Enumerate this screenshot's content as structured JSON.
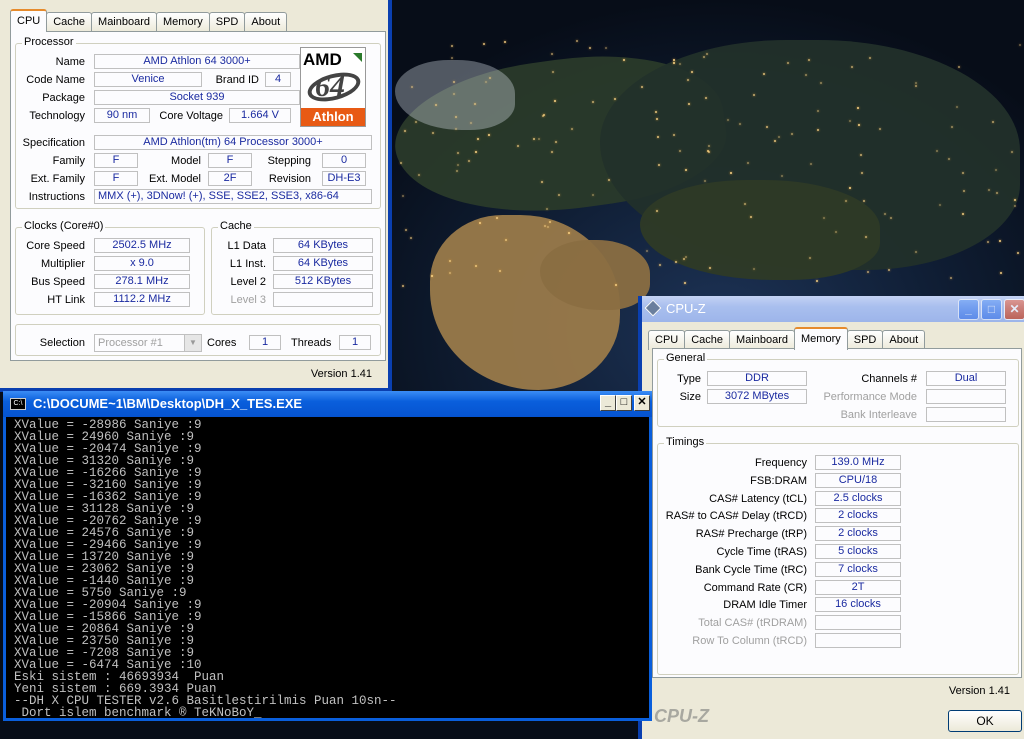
{
  "cpuz_main": {
    "tabs": [
      "CPU",
      "Cache",
      "Mainboard",
      "Memory",
      "SPD",
      "About"
    ],
    "processor": {
      "group_title": "Processor",
      "name_label": "Name",
      "name": "AMD Athlon 64 3000+",
      "codename_label": "Code Name",
      "codename": "Venice",
      "brandid_label": "Brand ID",
      "brandid": "4",
      "package_label": "Package",
      "package": "Socket 939",
      "technology_label": "Technology",
      "technology": "90 nm",
      "corevoltage_label": "Core Voltage",
      "corevoltage": "1.664 V",
      "spec_label": "Specification",
      "spec": "AMD Athlon(tm) 64 Processor 3000+",
      "family_label": "Family",
      "family": "F",
      "model_label": "Model",
      "model": "F",
      "stepping_label": "Stepping",
      "stepping": "0",
      "extfamily_label": "Ext. Family",
      "extfamily": "F",
      "extmodel_label": "Ext. Model",
      "extmodel": "2F",
      "revision_label": "Revision",
      "revision": "DH-E3",
      "instructions_label": "Instructions",
      "instructions": "MMX (+), 3DNow! (+), SSE, SSE2, SSE3, x86-64"
    },
    "logo": {
      "brand": "AMD",
      "number": "64",
      "product": "Athlon"
    },
    "clocks": {
      "group_title": "Clocks (Core#0)",
      "corespeed_label": "Core Speed",
      "corespeed": "2502.5 MHz",
      "multiplier_label": "Multiplier",
      "multiplier": "x 9.0",
      "busspeed_label": "Bus Speed",
      "busspeed": "278.1 MHz",
      "htlink_label": "HT Link",
      "htlink": "1112.2 MHz"
    },
    "cache": {
      "group_title": "Cache",
      "l1data_label": "L1 Data",
      "l1data": "64 KBytes",
      "l1inst_label": "L1 Inst.",
      "l1inst": "64 KBytes",
      "level2_label": "Level 2",
      "level2": "512 KBytes",
      "level3_label": "Level 3",
      "level3": ""
    },
    "selection_label": "Selection",
    "selection": "Processor #1",
    "cores_label": "Cores",
    "cores": "1",
    "threads_label": "Threads",
    "threads": "1",
    "version": "Version 1.41"
  },
  "cpuz_memory": {
    "title": "CPU-Z",
    "tabs": [
      "CPU",
      "Cache",
      "Mainboard",
      "Memory",
      "SPD",
      "About"
    ],
    "general": {
      "group_title": "General",
      "type_label": "Type",
      "type": "DDR",
      "size_label": "Size",
      "size": "3072 MBytes",
      "channels_label": "Channels #",
      "channels": "Dual",
      "perfmode_label": "Performance Mode",
      "perfmode": "",
      "bankinterleave_label": "Bank Interleave",
      "bankinterleave": ""
    },
    "timings": {
      "group_title": "Timings",
      "rows": [
        {
          "label": "Frequency",
          "value": "139.0 MHz",
          "disabled": false
        },
        {
          "label": "FSB:DRAM",
          "value": "CPU/18",
          "disabled": false
        },
        {
          "label": "CAS# Latency (tCL)",
          "value": "2.5 clocks",
          "disabled": false
        },
        {
          "label": "RAS# to CAS# Delay (tRCD)",
          "value": "2 clocks",
          "disabled": false
        },
        {
          "label": "RAS# Precharge (tRP)",
          "value": "2 clocks",
          "disabled": false
        },
        {
          "label": "Cycle Time (tRAS)",
          "value": "5 clocks",
          "disabled": false
        },
        {
          "label": "Bank Cycle Time (tRC)",
          "value": "7 clocks",
          "disabled": false
        },
        {
          "label": "Command Rate (CR)",
          "value": "2T",
          "disabled": false
        },
        {
          "label": "DRAM Idle Timer",
          "value": "16 clocks",
          "disabled": false
        },
        {
          "label": "Total CAS# (tRDRAM)",
          "value": "",
          "disabled": true
        },
        {
          "label": "Row To Column (tRCD)",
          "value": "",
          "disabled": true
        }
      ]
    },
    "version": "Version 1.41",
    "watermark": "CPU-Z",
    "ok_label": "OK"
  },
  "console": {
    "title": "C:\\DOCUME~1\\BM\\Desktop\\DH_X_TES.EXE",
    "icon_text": "C:\\",
    "lines": [
      "XValue = -28986 Saniye :9",
      "XValue = 24960 Saniye :9",
      "XValue = -20474 Saniye :9",
      "XValue = 31320 Saniye :9",
      "XValue = -16266 Saniye :9",
      "XValue = -32160 Saniye :9",
      "XValue = -16362 Saniye :9",
      "XValue = 31128 Saniye :9",
      "XValue = -20762 Saniye :9",
      "XValue = 24576 Saniye :9",
      "XValue = -29466 Saniye :9",
      "XValue = 13720 Saniye :9",
      "XValue = 23062 Saniye :9",
      "XValue = -1440 Saniye :9",
      "XValue = 5750 Saniye :9",
      "XValue = -20904 Saniye :9",
      "XValue = -15866 Saniye :9",
      "XValue = 20864 Saniye :9",
      "XValue = 23750 Saniye :9",
      "XValue = -7208 Saniye :9",
      "XValue = -6474 Saniye :10",
      "Eski sistem : 46693934  Puan",
      "Yeni sistem : 669.3934 Puan",
      "--DH X CPU TESTER v2.6 Basitlestirilmis Puan 10sn--",
      " Dort islem benchmark ® TeKNoBoY_"
    ]
  }
}
